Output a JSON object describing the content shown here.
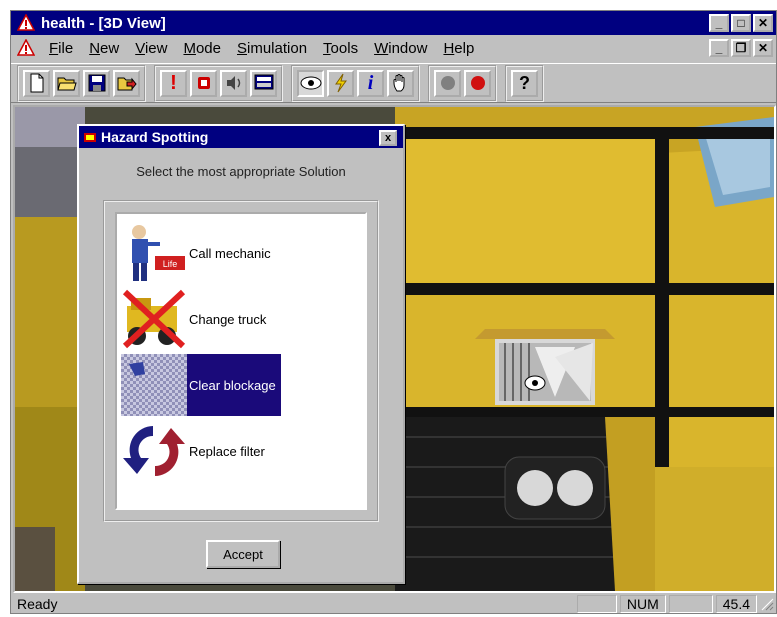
{
  "window": {
    "title": "health - [3D View]",
    "min_label": "_",
    "max_label": "□",
    "close_label": "✕",
    "restore_label": "❐"
  },
  "menu": {
    "items": [
      {
        "label": "File",
        "mnemonic": "F"
      },
      {
        "label": "New",
        "mnemonic": "N"
      },
      {
        "label": "View",
        "mnemonic": "V"
      },
      {
        "label": "Mode",
        "mnemonic": "M"
      },
      {
        "label": "Simulation",
        "mnemonic": "S"
      },
      {
        "label": "Tools",
        "mnemonic": "T"
      },
      {
        "label": "Window",
        "mnemonic": "W"
      },
      {
        "label": "Help",
        "mnemonic": "H"
      }
    ]
  },
  "toolbar": {
    "icons": [
      "new-file-icon",
      "open-folder-icon",
      "save-icon",
      "export-icon",
      "alert-icon",
      "stop-icon",
      "speaker-icon",
      "monitor-icon",
      "eye-icon",
      "lightning-icon",
      "info-icon",
      "hand-icon",
      "gray-record-icon",
      "red-record-icon",
      "help-icon"
    ],
    "info_glyph": "i",
    "help_glyph": "?",
    "alert_glyph": "!"
  },
  "dialog": {
    "title": "Hazard Spotting",
    "close_label": "x",
    "prompt": "Select the most appropriate Solution",
    "options": [
      {
        "label": "Call mechanic",
        "icon": "mechanic-icon",
        "badge": "Life"
      },
      {
        "label": "Change truck",
        "icon": "crossed-truck-icon"
      },
      {
        "label": "Clear blockage",
        "icon": "blockage-icon"
      },
      {
        "label": "Replace filter",
        "icon": "replace-arrows-icon"
      }
    ],
    "selected_index": 2,
    "accept_label": "Accept"
  },
  "statusbar": {
    "text": "Ready",
    "num": "NUM",
    "value": "45.4"
  },
  "colors": {
    "title_bar": "#000080",
    "selection": "#1a0a7a",
    "truck_yellow": "#d4b429",
    "chrome": "#c0c0c0"
  }
}
